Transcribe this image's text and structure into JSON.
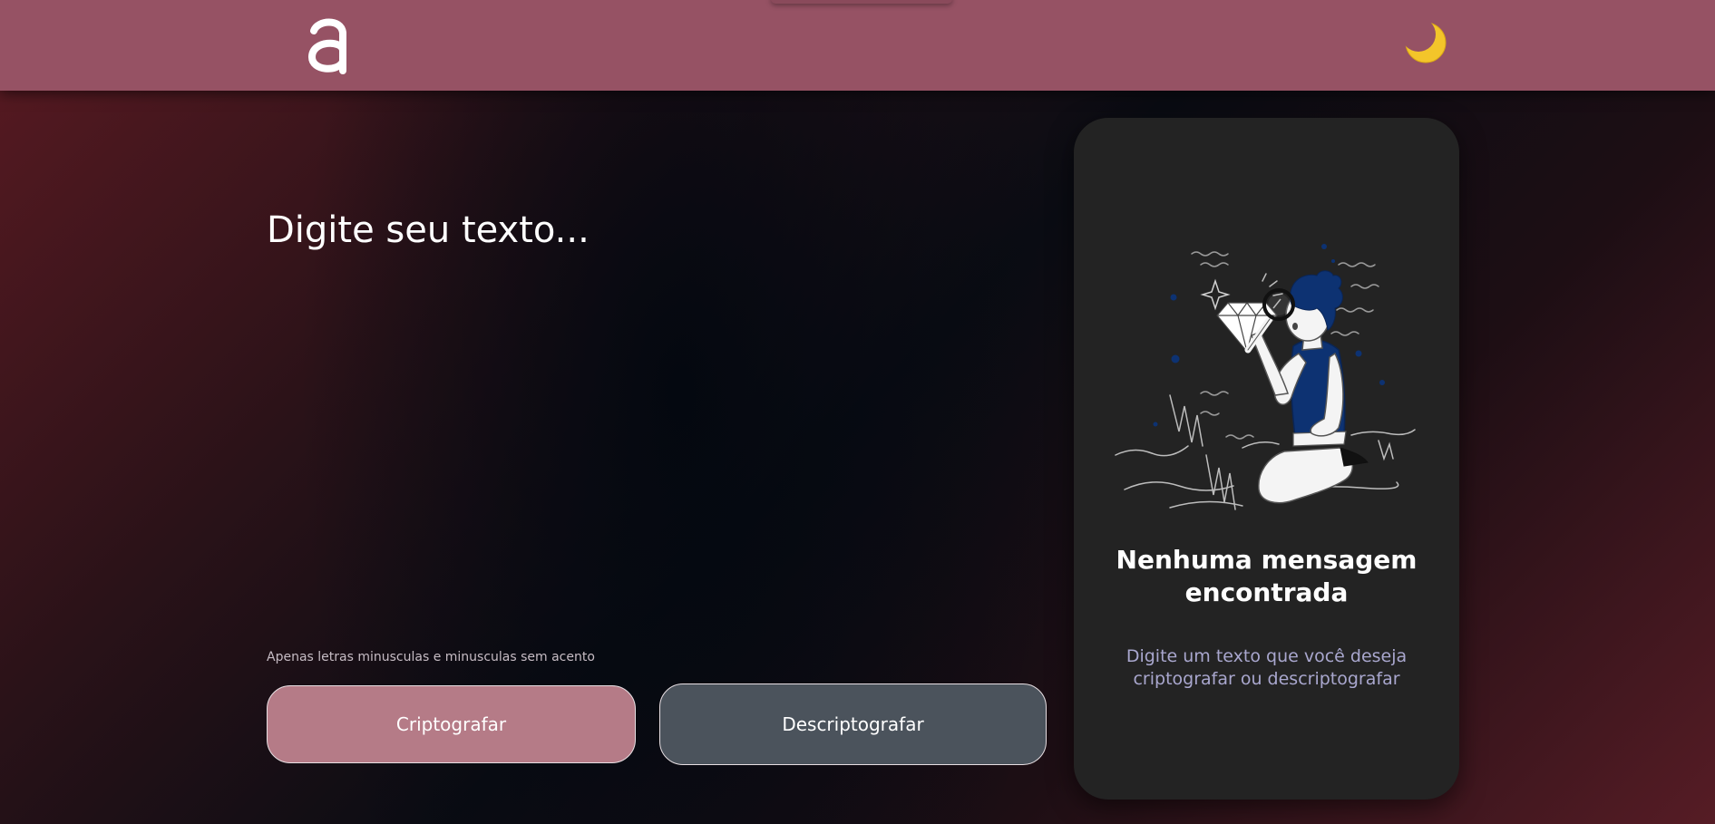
{
  "header": {
    "logo_icon": "letter-a-logo-icon",
    "theme_toggle_icon": "crescent-moon-icon"
  },
  "input": {
    "placeholder": "Digite seu texto...",
    "value": ""
  },
  "hint": "Apenas letras minusculas e minusculas sem acento",
  "buttons": {
    "encrypt_label": "Criptografar",
    "decrypt_label": "Descriptografar"
  },
  "output_panel": {
    "illustration_icon": "person-searching-with-magnifier-illustration",
    "title": "Nenhuma mensagem encontrada",
    "text": "Digite um texto que você deseja criptografar ou descriptografar"
  },
  "colors": {
    "header_bg": "#965264",
    "encrypt_button": "#b57b87",
    "decrypt_button": "#4b535c",
    "panel_bg": "#232323",
    "panel_text": "#a9a7ce",
    "illustration_accent": "#0d3272"
  }
}
